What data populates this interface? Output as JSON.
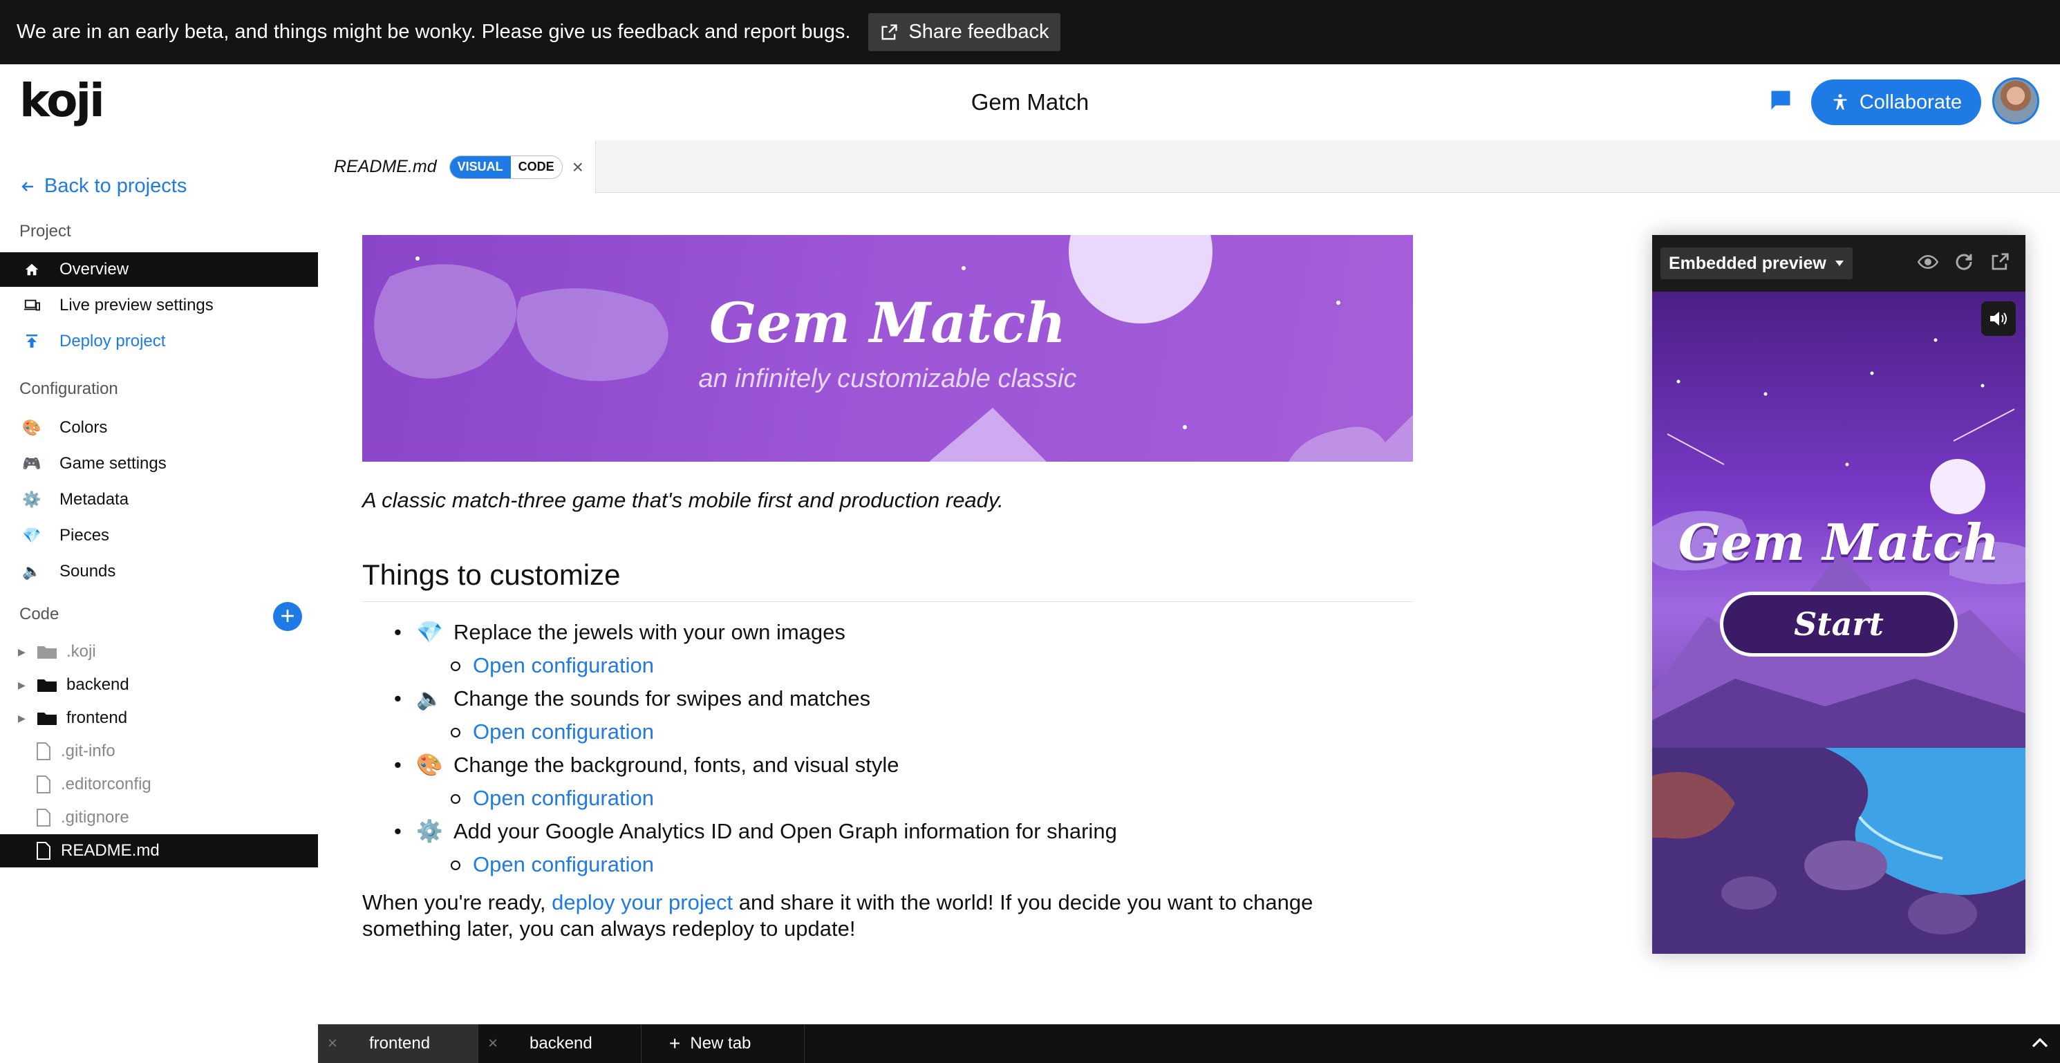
{
  "banner": {
    "text": "We are in an early beta, and things might be wonky. Please give us feedback and report bugs.",
    "feedback_label": "Share feedback"
  },
  "header": {
    "logo": "koji",
    "title": "Gem Match",
    "collaborate_label": "Collaborate"
  },
  "sidebar": {
    "back_label": "Back to projects",
    "project_heading": "Project",
    "project_items": [
      {
        "label": "Overview",
        "icon": "home-icon"
      },
      {
        "label": "Live preview settings",
        "icon": "devices-icon"
      },
      {
        "label": "Deploy project",
        "icon": "upload-icon"
      }
    ],
    "config_heading": "Configuration",
    "config_items": [
      {
        "label": "Colors",
        "icon": "🎨"
      },
      {
        "label": "Game settings",
        "icon": "🎮"
      },
      {
        "label": "Metadata",
        "icon": "⚙️"
      },
      {
        "label": "Pieces",
        "icon": "💎"
      },
      {
        "label": "Sounds",
        "icon": "🔈"
      }
    ],
    "code_heading": "Code",
    "tree": [
      {
        "label": ".koji",
        "type": "folder"
      },
      {
        "label": "backend",
        "type": "folder"
      },
      {
        "label": "frontend",
        "type": "folder"
      },
      {
        "label": ".git-info",
        "type": "file"
      },
      {
        "label": ".editorconfig",
        "type": "file"
      },
      {
        "label": ".gitignore",
        "type": "file"
      },
      {
        "label": "README.md",
        "type": "file"
      }
    ]
  },
  "editor": {
    "tab_name": "README.md",
    "mode_visual": "VISUAL",
    "mode_code": "CODE"
  },
  "doc": {
    "hero_title": "Gem Match",
    "hero_subtitle": "an infinitely customizable classic",
    "tagline": "A classic match-three game that's mobile first and production ready.",
    "heading": "Things to customize",
    "items": [
      {
        "emoji": "💎",
        "text": "Replace the jewels with your own images",
        "link": "Open configuration"
      },
      {
        "emoji": "🔈",
        "text": "Change the sounds for swipes and matches",
        "link": "Open configuration"
      },
      {
        "emoji": "🎨",
        "text": "Change the background, fonts, and visual style",
        "link": "Open configuration"
      },
      {
        "emoji": "⚙️",
        "text": "Add your Google Analytics ID and Open Graph information for sharing",
        "link": "Open configuration"
      }
    ],
    "closing_before": "When you're ready, ",
    "closing_link": "deploy your project",
    "closing_after": " and share it with the world! If you decide you want to change something later, you can always redeploy to update!"
  },
  "preview": {
    "mode_label": "Embedded preview",
    "game_title": "Gem Match",
    "start_label": "Start"
  },
  "bottom_tabs": {
    "tab1": "frontend",
    "tab2": "backend",
    "new_tab": "New tab"
  },
  "colors": {
    "accent": "#1e7be6",
    "banner_bg": "#141414",
    "active_nav_bg": "#111111"
  }
}
